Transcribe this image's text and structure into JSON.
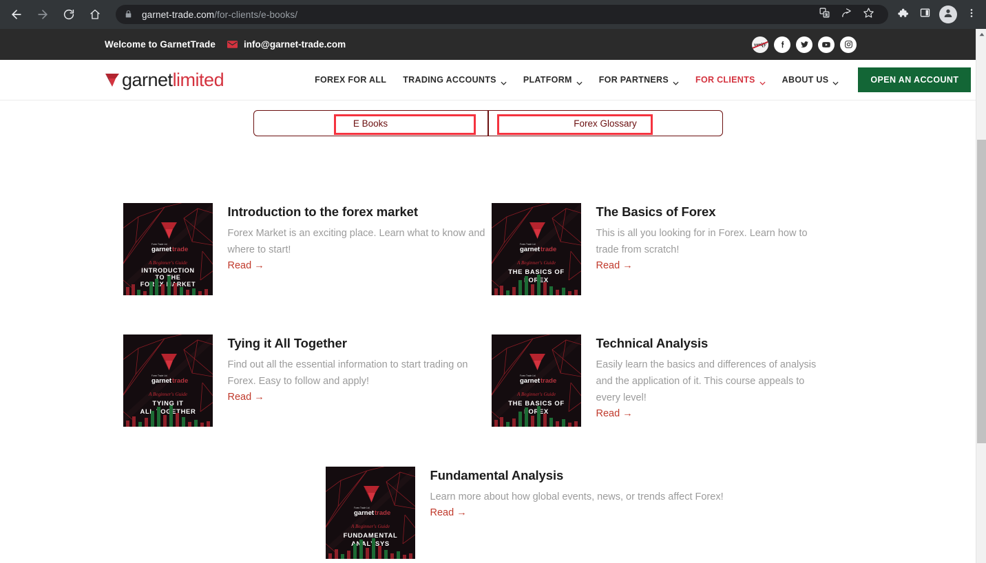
{
  "browser": {
    "url_domain": "garnet-trade.com",
    "url_path": "/for-clients/e-books/",
    "back_icon": "back-arrow-icon",
    "forward_icon": "forward-arrow-icon",
    "reload_icon": "reload-icon",
    "home_icon": "home-icon",
    "lock_icon": "lock-icon",
    "translate_icon": "translate-icon",
    "share_icon": "share-icon",
    "bookmark_icon": "star-icon",
    "extensions_icon": "puzzle-icon",
    "sidepanel_icon": "side-panel-icon",
    "profile_icon": "profile-avatar-icon",
    "menu_icon": "three-dot-menu-icon"
  },
  "topbar": {
    "welcome": "Welcome to GarnetTrade",
    "email": "info@garnet-trade.com",
    "mail_icon": "envelope-icon",
    "socials": [
      {
        "name": "verify-badge-icon",
        "label": "verify"
      },
      {
        "name": "facebook-icon",
        "label": "f"
      },
      {
        "name": "twitter-icon",
        "label": ""
      },
      {
        "name": "youtube-icon",
        "label": ""
      },
      {
        "name": "instagram-icon",
        "label": ""
      }
    ]
  },
  "nav": {
    "logo_primary": "garnet",
    "logo_secondary": "limited",
    "logo_icon": "garnet-gem-icon",
    "items": [
      {
        "label": "FOREX FOR ALL",
        "has_caret": false,
        "active": false
      },
      {
        "label": "TRADING ACCOUNTS",
        "has_caret": true,
        "active": false
      },
      {
        "label": "PLATFORM",
        "has_caret": true,
        "active": false
      },
      {
        "label": "FOR PARTNERS",
        "has_caret": true,
        "active": false
      },
      {
        "label": "FOR CLIENTS",
        "has_caret": true,
        "active": true
      },
      {
        "label": "ABOUT US",
        "has_caret": true,
        "active": false
      }
    ],
    "cta_label": "OPEN AN ACCOUNT"
  },
  "tabs": {
    "items": [
      {
        "label": "E Books",
        "highlighted": true
      },
      {
        "label": "Forex Glossary",
        "highlighted": true
      }
    ]
  },
  "books": [
    {
      "title": "Introduction to the forex market",
      "description": "Forex Market is an exciting place. Learn what to know and where to start!",
      "read_label": "Read →",
      "cover": {
        "brand_white": "garnet",
        "brand_red": "trade",
        "tagline": "A Beginner's Guide",
        "lines": [
          "INTRODUCTION",
          "TO THE",
          "FOREX MARKET"
        ]
      }
    },
    {
      "title": "The Basics of Forex",
      "description": "This is all you looking for in Forex. Learn how to trade from scratch!",
      "read_label": "Read →",
      "cover": {
        "brand_white": "garnet",
        "brand_red": "trade",
        "tagline": "A Beginner's Guide",
        "lines": [
          "THE BASICS OF",
          "FOREX"
        ]
      }
    },
    {
      "title": "Tying it All Together",
      "description": "Find out all the essential information to start trading on Forex. Easy to follow and apply!",
      "read_label": "Read →",
      "cover": {
        "brand_white": "garnet",
        "brand_red": "trade",
        "tagline": "A Beginner's Guide",
        "lines": [
          "TYING IT",
          "ALL TOGETHER"
        ]
      }
    },
    {
      "title": "Technical Analysis",
      "description": "Easily learn the basics and differences of analysis and the application of it. This course appeals to every level!",
      "read_label": "Read →",
      "cover": {
        "brand_white": "garnet",
        "brand_red": "trade",
        "tagline": "A Beginner's Guide",
        "lines": [
          "THE BASICS OF",
          "FOREX"
        ]
      }
    },
    {
      "title": "Fundamental Analysis",
      "description": "Learn more about how global events, news, or trends affect Forex!",
      "read_label": "Read →",
      "cover": {
        "brand_white": "garnet",
        "brand_red": "trade",
        "tagline": "A Beginner's Guide",
        "lines": [
          "FUNDAMENTAL",
          "ANALYSYS"
        ]
      }
    }
  ],
  "colors": {
    "brand_red": "#d4333f",
    "link_red": "#c0392b",
    "cta_green": "#136636",
    "tab_border": "#6b0f0f",
    "highlight": "#f5333f",
    "topbar_bg": "#2b2b2b",
    "chrome_bg": "#323639"
  }
}
